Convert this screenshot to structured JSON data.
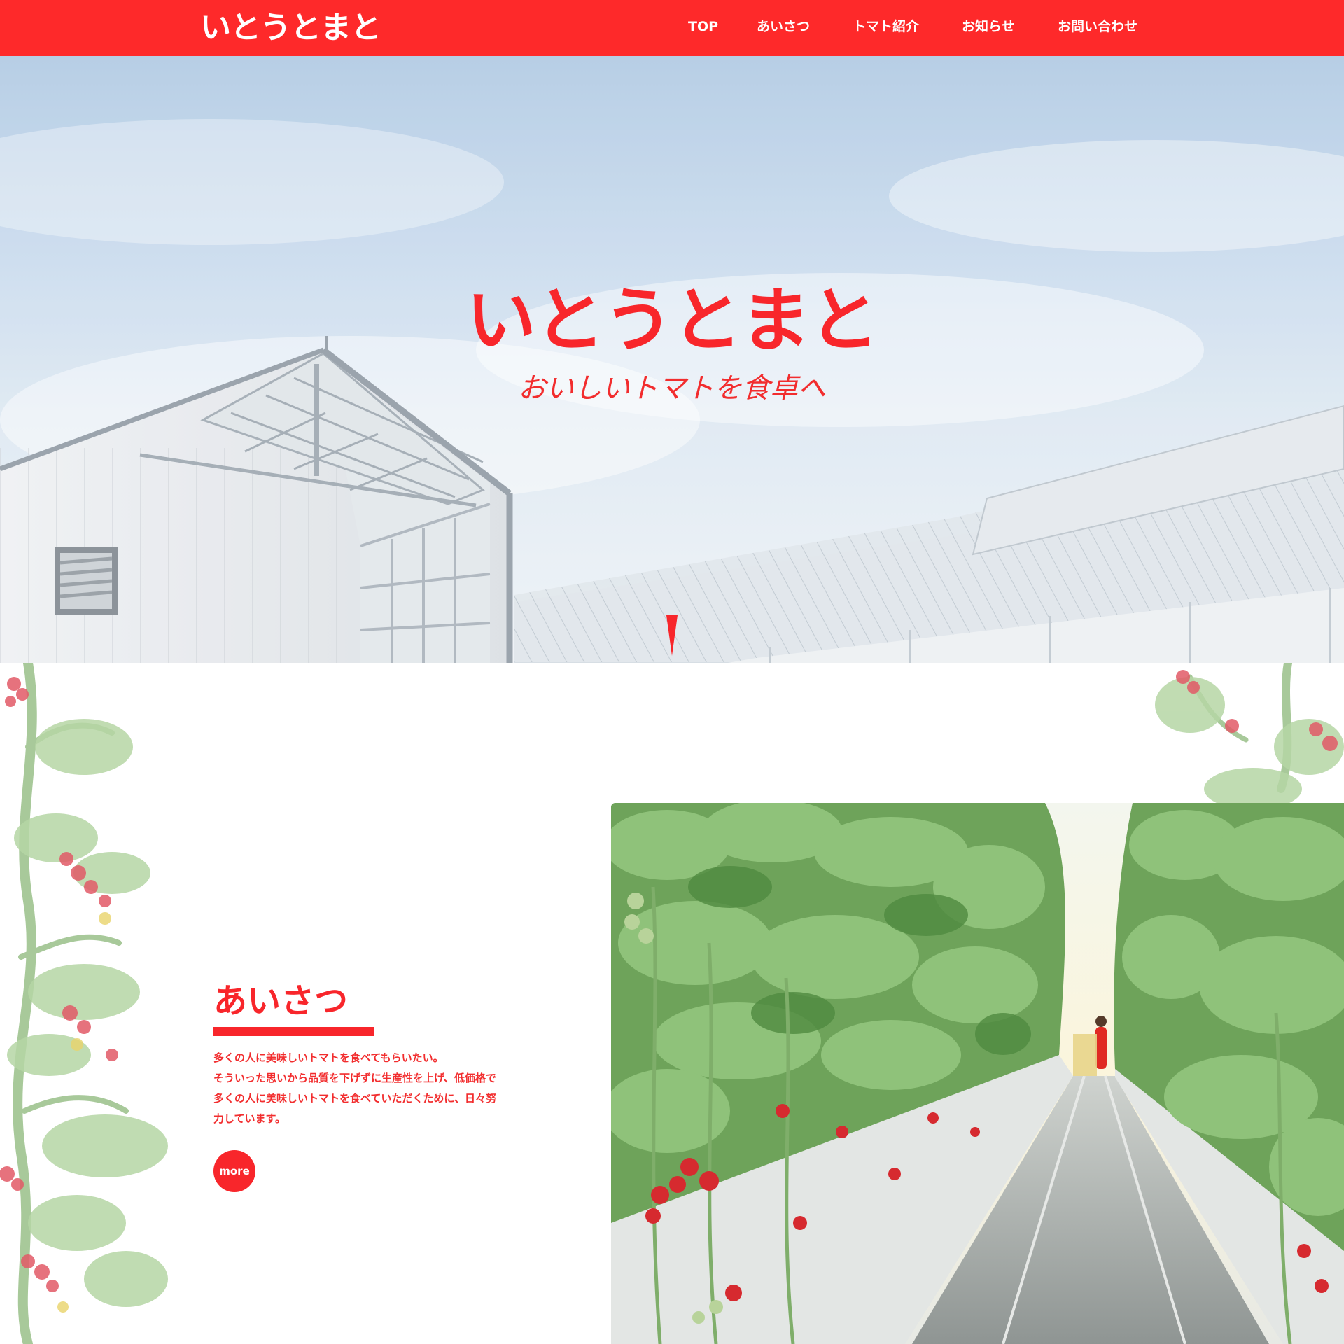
{
  "brand": {
    "logo_text": "いとうとまと",
    "primary_color": "#fe292a"
  },
  "nav": {
    "items": [
      {
        "label": "TOP"
      },
      {
        "label": "あいさつ"
      },
      {
        "label": "トマト紹介"
      },
      {
        "label": "お知らせ"
      },
      {
        "label": "お問い合わせ"
      }
    ]
  },
  "hero": {
    "title": "いとうとまと",
    "tagline": "おいしいトマトを食卓へ",
    "scroll_icon": "scroll-down-arrow-icon"
  },
  "greeting": {
    "heading": "あいさつ",
    "body": "多くの人に美味しいトマトを食べてもらいたい。\nそういった思いから品質を下げずに生産性を上げ、低価格で\n多くの人に美味しいトマトを食べていただくために、日々努\n力しています。",
    "more_label": "more"
  }
}
